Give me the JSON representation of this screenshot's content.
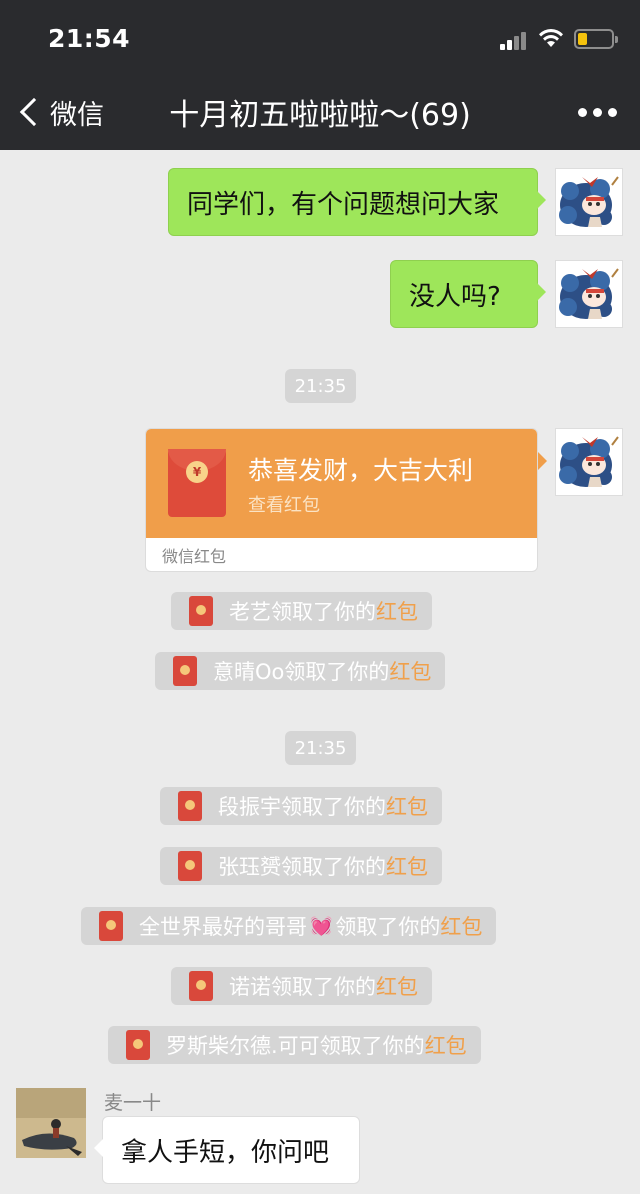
{
  "status_bar": {
    "time": "21:54"
  },
  "nav": {
    "back_label": "微信",
    "title": "十月初五啦啦啦～(69)"
  },
  "messages": {
    "m1": "同学们，有个问题想问大家",
    "m2": "没人吗?",
    "time1": "21:35",
    "red_packet": {
      "title": "恭喜发财，大吉大利",
      "subtitle": "查看红包",
      "footer": "微信红包",
      "coin": "¥"
    },
    "time2": "21:35",
    "receipts": [
      {
        "name": "老艺",
        "text": "领取了你的",
        "link": "红包"
      },
      {
        "name": "意晴Oo",
        "text": "领取了你的",
        "link": "红包"
      },
      {
        "name": "段振宇",
        "text": "领取了你的",
        "link": "红包"
      },
      {
        "name": "张珏赟",
        "text": "领取了你的",
        "link": "红包"
      },
      {
        "name": "全世界最好的哥哥",
        "emoji": "💓",
        "text": "领取了你的",
        "link": "红包"
      },
      {
        "name": "诺诺",
        "text": "领取了你的",
        "link": "红包"
      },
      {
        "name": "罗斯柴尔德.可可",
        "text": "领取了你的",
        "link": "红包"
      }
    ],
    "other": {
      "sender": "麦一十",
      "text": "拿人手短，你问吧"
    }
  }
}
